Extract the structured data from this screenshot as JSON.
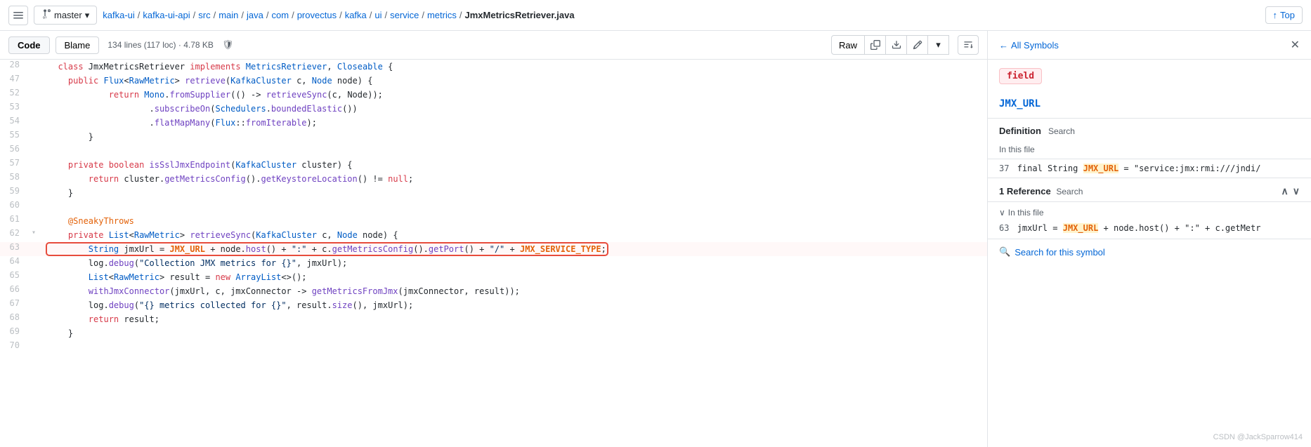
{
  "topbar": {
    "branch": "master",
    "breadcrumb": [
      {
        "label": "kafka-ui",
        "href": "#"
      },
      {
        "label": "kafka-ui-api",
        "href": "#"
      },
      {
        "label": "src",
        "href": "#"
      },
      {
        "label": "main",
        "href": "#"
      },
      {
        "label": "java",
        "href": "#"
      },
      {
        "label": "com",
        "href": "#"
      },
      {
        "label": "provectus",
        "href": "#"
      },
      {
        "label": "kafka",
        "href": "#"
      },
      {
        "label": "ui",
        "href": "#"
      },
      {
        "label": "service",
        "href": "#"
      },
      {
        "label": "metrics",
        "href": "#"
      },
      {
        "label": "JmxMetricsRetriever.java",
        "current": true
      }
    ],
    "top_label": "Top"
  },
  "code_toolbar": {
    "tab_code": "Code",
    "tab_blame": "Blame",
    "file_meta": "134 lines (117 loc) · 4.78 KB",
    "raw_label": "Raw"
  },
  "code_lines": [
    {
      "num": 28,
      "indent": 0,
      "text": "  class JmxMetricsRetriever implements MetricsRetriever, Closeable {"
    },
    {
      "num": 47,
      "indent": 0,
      "text": "    public Flux<RawMetric> retrieve(KafkaCluster c, Node node) {"
    },
    {
      "num": 52,
      "indent": 0,
      "text": "            return Mono.fromSupplier(() -> retrieveSync(c, Node));"
    },
    {
      "num": 53,
      "indent": 0,
      "text": "                    .subscribeOn(Schedulers.boundedElastic())"
    },
    {
      "num": 54,
      "indent": 0,
      "text": "                    .flatMapMany(Flux::fromIterable);"
    },
    {
      "num": 55,
      "indent": 0,
      "text": "        }"
    },
    {
      "num": 56,
      "indent": 0,
      "text": ""
    },
    {
      "num": 57,
      "indent": 0,
      "text": "    private boolean isSslJmxEndpoint(KafkaCluster cluster) {"
    },
    {
      "num": 58,
      "indent": 0,
      "text": "        return cluster.getMetricsConfig().getKeystoreLocation() != null;"
    },
    {
      "num": 59,
      "indent": 0,
      "text": "    }"
    },
    {
      "num": 60,
      "indent": 0,
      "text": ""
    },
    {
      "num": 61,
      "indent": 0,
      "text": "    @SneakyThrows"
    },
    {
      "num": 62,
      "indent": 0,
      "text": "    private List<RawMetric> retrieveSync(KafkaCluster c, Node node) {"
    },
    {
      "num": 63,
      "indent": 0,
      "text": "        String jmxUrl = JMX_URL + node.host() + \":\" + c.getMetricsConfig().getPort() + \"/\" + JMX_SERVICE_TYPE;",
      "highlighted": true
    },
    {
      "num": 64,
      "indent": 0,
      "text": "        log.debug(\"Collection JMX metrics for {}\", jmxUrl);"
    },
    {
      "num": 65,
      "indent": 0,
      "text": "        List<RawMetric> result = new ArrayList<>();"
    },
    {
      "num": 66,
      "indent": 0,
      "text": "        withJmxConnector(jmxUrl, c, jmxConnector -> getMetricsFromJmx(jmxConnector, result));"
    },
    {
      "num": 67,
      "indent": 0,
      "text": "        log.debug(\"{} metrics collected for {}\", result.size(), jmxUrl);"
    },
    {
      "num": 68,
      "indent": 0,
      "text": "        return result;"
    },
    {
      "num": 69,
      "indent": 0,
      "text": "    }"
    },
    {
      "num": 70,
      "indent": 0,
      "text": ""
    }
  ],
  "right_panel": {
    "all_symbols_label": "All Symbols",
    "symbol_tag": "field",
    "symbol_name": "JMX_URL",
    "definition_label": "Definition",
    "definition_search_placeholder": "Search",
    "in_this_file_label": "In this file",
    "def_line_num": "37",
    "def_line_code": "final String JMX_URL = \"service:jmx:rmi:///jndi/",
    "def_line_highlight": "JMX_URL",
    "reference_label": "1 Reference",
    "reference_search_placeholder": "Search",
    "in_this_file_sub_label": "In this file",
    "ref_line_num": "63",
    "ref_line_code": "jmxUrl = JMX_URL + node.host() + \":\" + c.getMetr",
    "ref_line_highlight": "JMX_URL",
    "search_symbol_label": "Search for this symbol"
  },
  "watermark": "CSDN @JackSparrow414"
}
